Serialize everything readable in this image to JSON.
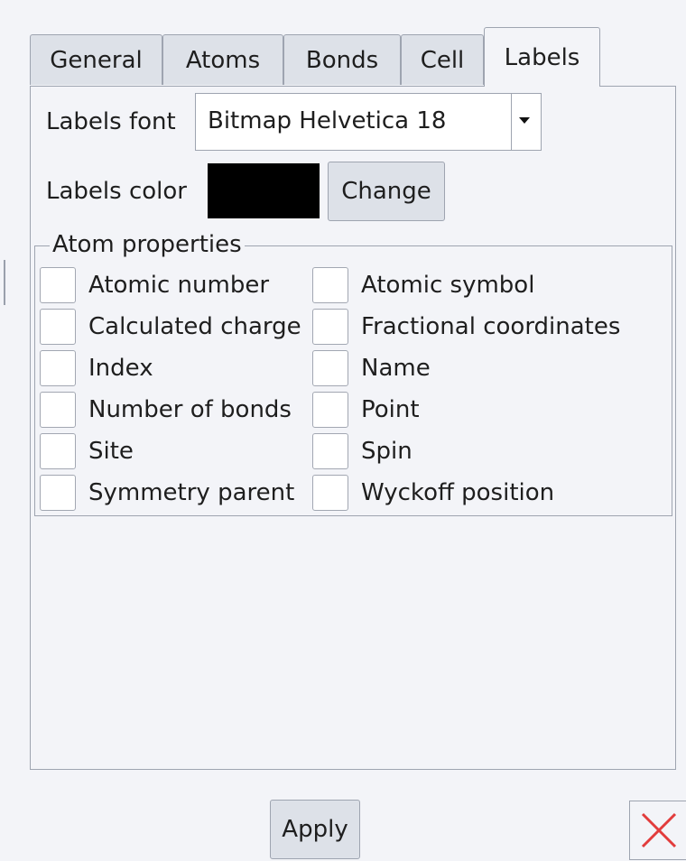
{
  "tabs": [
    {
      "label": "General",
      "active": false
    },
    {
      "label": "Atoms",
      "active": false
    },
    {
      "label": "Bonds",
      "active": false
    },
    {
      "label": "Cell",
      "active": false
    },
    {
      "label": "Labels",
      "active": true
    }
  ],
  "labels_font": {
    "label": "Labels font",
    "value": "Bitmap Helvetica 18"
  },
  "labels_color": {
    "label": "Labels color",
    "swatch_color": "#000000",
    "change_label": "Change"
  },
  "atom_properties": {
    "title": "Atom properties",
    "left": [
      {
        "label": "Atomic number",
        "checked": false
      },
      {
        "label": "Calculated charge",
        "checked": false
      },
      {
        "label": "Index",
        "checked": false
      },
      {
        "label": "Number of bonds",
        "checked": false
      },
      {
        "label": "Site",
        "checked": false
      },
      {
        "label": "Symmetry parent",
        "checked": false
      }
    ],
    "right": [
      {
        "label": "Atomic symbol",
        "checked": false
      },
      {
        "label": "Fractional coordinates",
        "checked": false
      },
      {
        "label": "Name",
        "checked": false
      },
      {
        "label": "Point",
        "checked": false
      },
      {
        "label": "Spin",
        "checked": false
      },
      {
        "label": "Wyckoff position",
        "checked": false
      }
    ]
  },
  "footer": {
    "apply_label": "Apply",
    "close_icon": "close-x-icon",
    "close_icon_color": "#e23c3c"
  }
}
